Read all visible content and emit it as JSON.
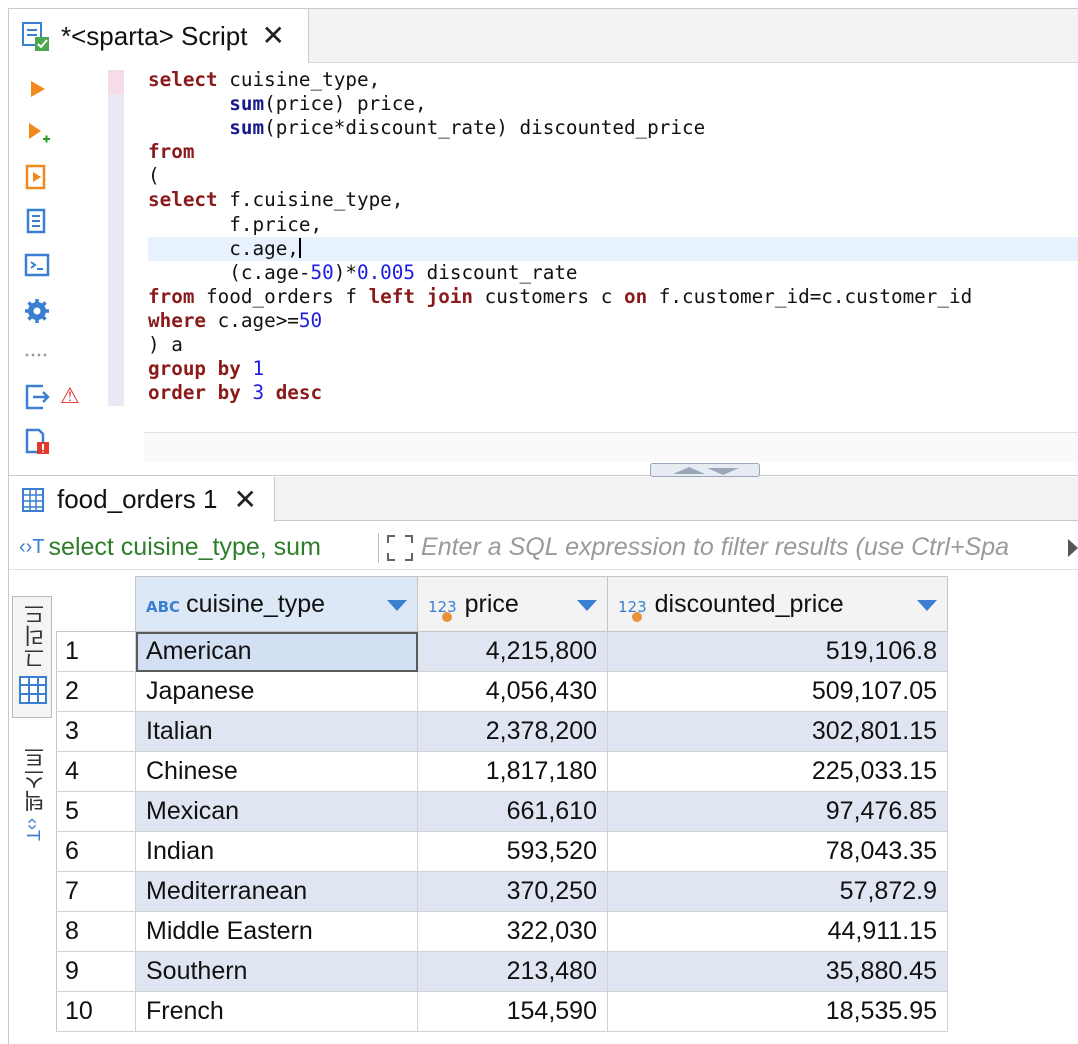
{
  "script_tab": {
    "title": "*<sparta> Script",
    "close": "✕"
  },
  "editor": {
    "lines": [
      [
        {
          "t": "select",
          "c": "kw"
        },
        {
          "t": " cuisine_type,",
          "c": ""
        }
      ],
      [
        {
          "t": "       ",
          "c": ""
        },
        {
          "t": "sum",
          "c": "fn"
        },
        {
          "t": "(price) price,",
          "c": ""
        }
      ],
      [
        {
          "t": "       ",
          "c": ""
        },
        {
          "t": "sum",
          "c": "fn"
        },
        {
          "t": "(price*discount_rate) discounted_price",
          "c": ""
        }
      ],
      [
        {
          "t": "from",
          "c": "kw"
        }
      ],
      [
        {
          "t": "(",
          "c": ""
        }
      ],
      [
        {
          "t": "select",
          "c": "kw"
        },
        {
          "t": " f.cuisine_type,",
          "c": ""
        }
      ],
      [
        {
          "t": "       f.price,",
          "c": ""
        }
      ],
      [
        {
          "t": "       c.age,",
          "c": ""
        },
        {
          "t": "",
          "c": "caret"
        }
      ],
      [
        {
          "t": "       (c.age-",
          "c": ""
        },
        {
          "t": "50",
          "c": "num"
        },
        {
          "t": ")*",
          "c": ""
        },
        {
          "t": "0.005",
          "c": "num"
        },
        {
          "t": " discount_rate",
          "c": ""
        }
      ],
      [
        {
          "t": "from",
          "c": "kw"
        },
        {
          "t": " food_orders f ",
          "c": ""
        },
        {
          "t": "left join",
          "c": "kw"
        },
        {
          "t": " customers c ",
          "c": ""
        },
        {
          "t": "on",
          "c": "kw"
        },
        {
          "t": " f.customer_id=c.customer_id",
          "c": ""
        }
      ],
      [
        {
          "t": "where",
          "c": "kw"
        },
        {
          "t": " c.age>=",
          "c": ""
        },
        {
          "t": "50",
          "c": "num"
        }
      ],
      [
        {
          "t": ") a",
          "c": ""
        }
      ],
      [
        {
          "t": "group by",
          "c": "kw"
        },
        {
          "t": " ",
          "c": ""
        },
        {
          "t": "1",
          "c": "num"
        }
      ],
      [
        {
          "t": "order by",
          "c": "kw"
        },
        {
          "t": " ",
          "c": ""
        },
        {
          "t": "3",
          "c": "num"
        },
        {
          "t": " ",
          "c": ""
        },
        {
          "t": "desc",
          "c": "kw"
        }
      ]
    ]
  },
  "toolbar": {
    "items": [
      "execute-statement-icon",
      "execute-statement-new-tab-icon",
      "execute-script-icon",
      "explain-plan-icon",
      "terminal-icon",
      "settings-icon",
      "more-icon",
      "export-icon",
      "problems-icon"
    ],
    "warning_icon": "⚠"
  },
  "results_tab": {
    "title": "food_orders 1",
    "close": "✕"
  },
  "filter": {
    "query": "select cuisine_type, sum",
    "placeholder": "Enter a SQL expression to filter results (use Ctrl+Spa"
  },
  "side_tabs": {
    "grid": "그리드",
    "text": "텍스트"
  },
  "grid": {
    "columns": [
      {
        "type": "ABC",
        "name": "cuisine_type"
      },
      {
        "type": "123",
        "name": "price"
      },
      {
        "type": "123",
        "name": "discounted_price"
      }
    ],
    "rows": [
      {
        "n": "1",
        "cuisine": "American",
        "price": "4,215,800",
        "disc": "519,106.8"
      },
      {
        "n": "2",
        "cuisine": "Japanese",
        "price": "4,056,430",
        "disc": "509,107.05"
      },
      {
        "n": "3",
        "cuisine": "Italian",
        "price": "2,378,200",
        "disc": "302,801.15"
      },
      {
        "n": "4",
        "cuisine": "Chinese",
        "price": "1,817,180",
        "disc": "225,033.15"
      },
      {
        "n": "5",
        "cuisine": "Mexican",
        "price": "661,610",
        "disc": "97,476.85"
      },
      {
        "n": "6",
        "cuisine": "Indian",
        "price": "593,520",
        "disc": "78,043.35"
      },
      {
        "n": "7",
        "cuisine": "Mediterranean",
        "price": "370,250",
        "disc": "57,872.9"
      },
      {
        "n": "8",
        "cuisine": "Middle Eastern",
        "price": "322,030",
        "disc": "44,911.15"
      },
      {
        "n": "9",
        "cuisine": "Southern",
        "price": "213,480",
        "disc": "35,880.45"
      },
      {
        "n": "10",
        "cuisine": "French",
        "price": "154,590",
        "disc": "18,535.95"
      }
    ]
  }
}
